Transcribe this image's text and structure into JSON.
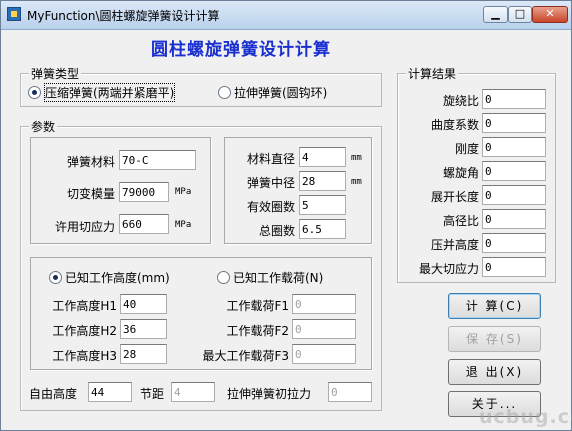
{
  "window": {
    "title": "MyFunction\\圆柱螺旋弹簧设计计算",
    "minimize": "▁",
    "maximize": "□",
    "close": "✕"
  },
  "main_title": "圆柱螺旋弹簧设计计算",
  "spring_type": {
    "label": "弹簧类型",
    "options": [
      "压缩弹簧(两端并紧磨平)",
      "拉伸弹簧(圆钩环)"
    ],
    "selected": 0
  },
  "params": {
    "label": "参数",
    "material": {
      "label": "弹簧材料",
      "value": "70-C"
    },
    "shear_modulus": {
      "label": "切变模量",
      "value": "79000",
      "unit": "MPa"
    },
    "allow_shear": {
      "label": "许用切应力",
      "value": "660",
      "unit": "MPa"
    },
    "wire_dia": {
      "label": "材料直径",
      "value": "4",
      "unit": "mm"
    },
    "mean_dia": {
      "label": "弹簧中径",
      "value": "28",
      "unit": "mm"
    },
    "active_coils": {
      "label": "有效圈数",
      "value": "5"
    },
    "total_coils": {
      "label": "总圈数",
      "value": "6.5"
    },
    "mode_options": [
      "已知工作高度(mm)",
      "已知工作载荷(N)"
    ],
    "mode_selected": 0,
    "heights": [
      {
        "label": "工作高度H1",
        "value": "40"
      },
      {
        "label": "工作高度H2",
        "value": "36"
      },
      {
        "label": "工作高度H3",
        "value": "28"
      }
    ],
    "loads": [
      {
        "label": "工作载荷F1",
        "value": "0"
      },
      {
        "label": "工作载荷F2",
        "value": "0"
      },
      {
        "label": "最大工作载荷F3",
        "value": "0"
      }
    ],
    "free_height": {
      "label": "自由高度",
      "value": "44"
    },
    "pitch": {
      "label": "节距",
      "value": "4"
    },
    "initial_tension": {
      "label": "拉伸弹簧初拉力",
      "value": "0"
    }
  },
  "results": {
    "label": "计算结果",
    "items": [
      {
        "label": "旋绕比",
        "value": "0"
      },
      {
        "label": "曲度系数",
        "value": "0"
      },
      {
        "label": "刚度",
        "value": "0"
      },
      {
        "label": "螺旋角",
        "value": "0"
      },
      {
        "label": "展开长度",
        "value": "0"
      },
      {
        "label": "高径比",
        "value": "0"
      },
      {
        "label": "压并高度",
        "value": "0"
      },
      {
        "label": "最大切应力",
        "value": "0"
      }
    ]
  },
  "buttons": {
    "calc": "计 算(C)",
    "save": "保 存(S)",
    "exit": "退 出(X)",
    "about": "关于..."
  },
  "watermark": "ucbug.cc"
}
